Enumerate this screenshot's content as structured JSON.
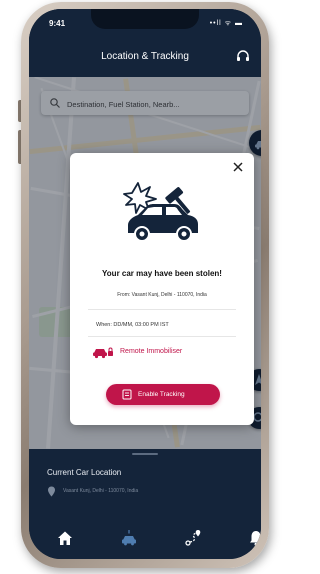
{
  "status_bar": {
    "time": "9:41",
    "icons": "••ll ᯤ ▬"
  },
  "header": {
    "title": "Location & Tracking",
    "right_icon": "headset-icon"
  },
  "search": {
    "placeholder": "Destination, Fuel Station, Nearb..."
  },
  "modal": {
    "title": "Your car may have been stolen!",
    "address": "From:  Vasant Kunj, Delhi - 110070, India",
    "when": "When: DD/MM, 03:00 PM IST",
    "immobiliser_label": "Remote Immobiliser",
    "enable_label": "Enable Tracking",
    "illustration": "car-theft-alert-icon"
  },
  "bottom_panel": {
    "title": "Current Car Location",
    "address": "Vasant Kunj, Delhi - 110070, India"
  },
  "nav": {
    "items": [
      "home-icon",
      "car-icon",
      "route-icon",
      "bell-icon"
    ],
    "active_index": 1
  },
  "colors": {
    "navy": "#14243a",
    "accent": "#c0154a",
    "map_bg": "#e9ebee",
    "nav_active": "#4f7db0",
    "pin_green": "#2e7d32"
  }
}
